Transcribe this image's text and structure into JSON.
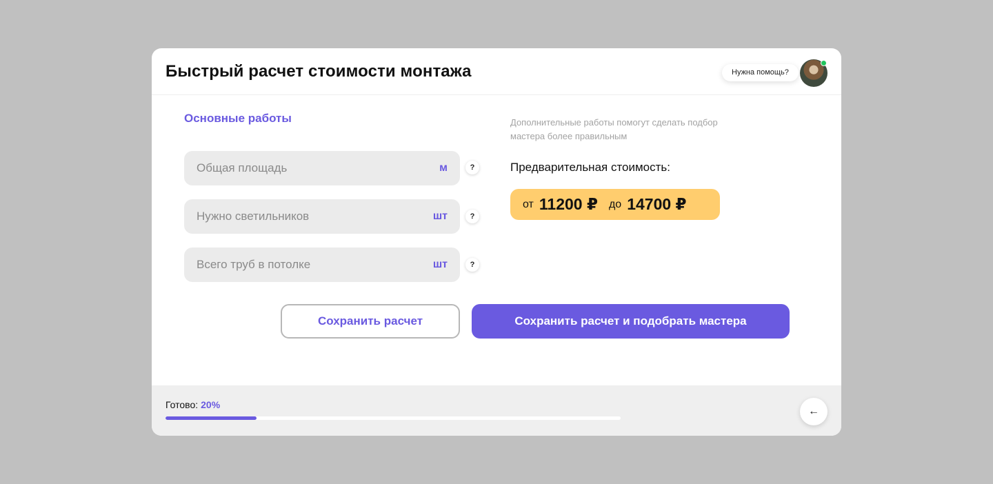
{
  "header": {
    "title": "Быстрый расчет стоимости монтажа",
    "help_label": "Нужна помощь?"
  },
  "main_works": {
    "title": "Основные работы",
    "fields": [
      {
        "placeholder": "Общая площадь",
        "unit": "м",
        "hint": "?"
      },
      {
        "placeholder": "Нужно светильников",
        "unit": "шт",
        "hint": "?"
      },
      {
        "placeholder": "Всего труб в потолке",
        "unit": "шт",
        "hint": "?"
      }
    ]
  },
  "info": {
    "note": "Дополнительные работы помогут сделать подбор мастера более правильным",
    "price_label": "Предварительная стоимость:",
    "price_from_prefix": "от",
    "price_from": "11200 ₽",
    "price_to_prefix": "до",
    "price_to": "14700 ₽"
  },
  "actions": {
    "save_label": "Сохранить расчет",
    "save_and_match_label": "Сохранить расчет и подобрать мастера"
  },
  "footer": {
    "progress_label": "Готово:",
    "progress_text": "20%",
    "progress_value": 0.2,
    "back_icon": "arrow-left-icon"
  },
  "colors": {
    "accent": "#6a5ae0",
    "price_badge": "#ffcd6e",
    "online": "#22c55e",
    "background": "#c0c0c0"
  }
}
